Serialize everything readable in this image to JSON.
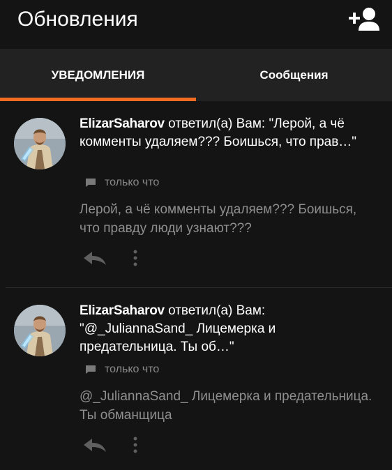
{
  "appbar": {
    "title": "Обновления",
    "action_icon": "add-friend-icon"
  },
  "tabs": [
    {
      "label": "УВЕДОМЛЕНИЯ",
      "active": true
    },
    {
      "label": "Сообщения",
      "active": false
    }
  ],
  "colors": {
    "background": "#141414",
    "tab_bar": "#222222",
    "accent": "#f26b22",
    "primary_text": "#ffffff",
    "secondary_text": "#8e8e8e"
  },
  "notifications": [
    {
      "username": "ElizarSaharov",
      "action": "ответил(а) Вам: \"Лерой, а чё комменты удаляем??? Боишься, что прав…\"",
      "time": "только что",
      "body": "Лерой, а чё комменты удаляем??? Боишься, что правду люди узнают???",
      "icons": [
        "avatar",
        "comment-icon",
        "reply-icon",
        "more-vertical-icon"
      ]
    },
    {
      "username": "ElizarSaharov",
      "action": "ответил(а) Вам: \"@_JuliannaSand_ Лицемерка и предательница. Ты об…\"",
      "time": "только что",
      "body": "@_JuliannaSand_ Лицемерка и предательница. Ты обманщица",
      "icons": [
        "avatar",
        "comment-icon",
        "reply-icon",
        "more-vertical-icon"
      ]
    }
  ]
}
